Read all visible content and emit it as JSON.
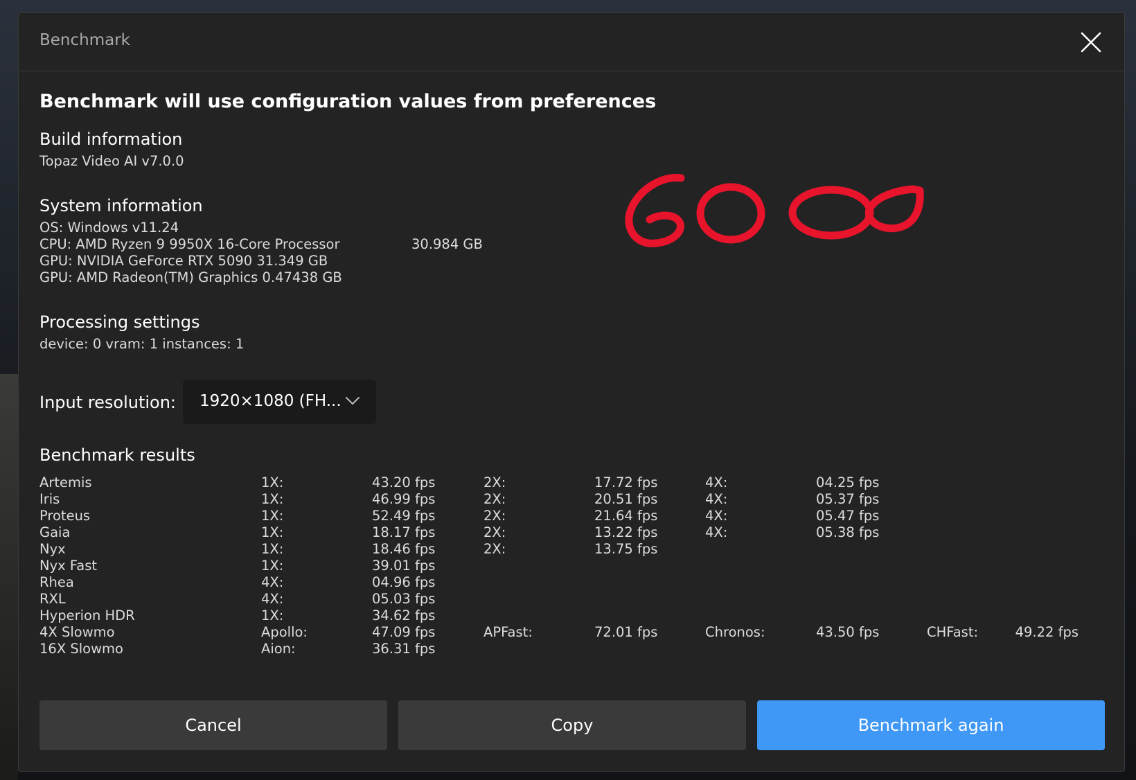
{
  "dialog": {
    "title": "Benchmark",
    "heading": "Benchmark will use configuration values from preferences"
  },
  "build": {
    "title": "Build information",
    "version": "Topaz Video AI v7.0.0"
  },
  "system": {
    "title": "System information",
    "os": "OS: Windows v11.24",
    "cpu": "CPU: AMD Ryzen 9 9950X 16-Core Processor",
    "cpu_memory": "30.984 GB",
    "gpu1": "GPU: NVIDIA GeForce RTX 5090  31.349 GB",
    "gpu2": "GPU: AMD Radeon(TM) Graphics  0.47438 GB"
  },
  "processing": {
    "title": "Processing settings",
    "values": "device: 0 vram: 1 instances: 1"
  },
  "input": {
    "label": "Input resolution:",
    "selected": "1920×1080 (FH..."
  },
  "results": {
    "title": "Benchmark results",
    "rows": [
      [
        "Artemis",
        "1X:",
        "43.20 fps",
        "2X:",
        "17.72 fps",
        "4X:",
        "04.25 fps"
      ],
      [
        "Iris",
        "1X:",
        "46.99 fps",
        "2X:",
        "20.51 fps",
        "4X:",
        "05.37 fps"
      ],
      [
        "Proteus",
        "1X:",
        "52.49 fps",
        "2X:",
        "21.64 fps",
        "4X:",
        "05.47 fps"
      ],
      [
        "Gaia",
        "1X:",
        "18.17 fps",
        "2X:",
        "13.22 fps",
        "4X:",
        "05.38 fps"
      ],
      [
        "Nyx",
        "1X:",
        "18.46 fps",
        "2X:",
        "13.75 fps"
      ],
      [
        "Nyx Fast",
        "1X:",
        "39.01 fps"
      ],
      [
        "Rhea",
        "4X:",
        "04.96 fps"
      ],
      [
        "RXL",
        "4X:",
        "05.03 fps"
      ],
      [
        "Hyperion HDR",
        "1X:",
        "34.62 fps"
      ],
      [
        "4X Slowmo",
        "Apollo:",
        "47.09 fps",
        "APFast:",
        "72.01 fps",
        "Chronos:",
        "43.50 fps",
        "CHFast:",
        "49.22 fps"
      ],
      [
        "16X Slowmo",
        "Aion:",
        "36.31 fps"
      ]
    ]
  },
  "buttons": {
    "cancel": "Cancel",
    "copy": "Copy",
    "again": "Benchmark again"
  },
  "annotation": {
    "handwritten": "6000",
    "color": "#e8142c"
  },
  "colors": {
    "accent": "#3f98f6",
    "dialog_bg": "#232323"
  }
}
